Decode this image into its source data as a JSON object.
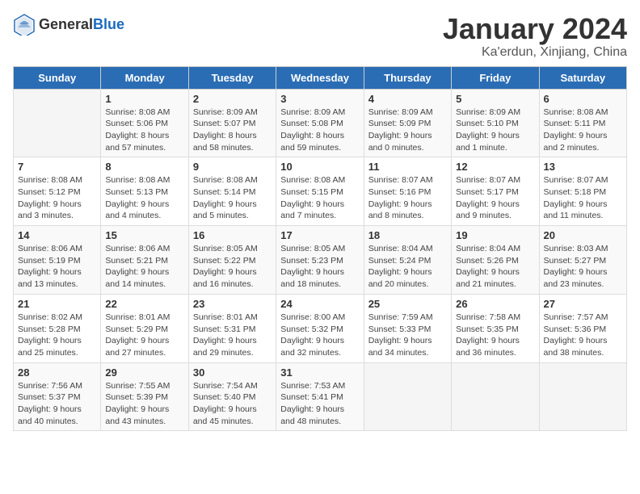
{
  "logo": {
    "text_general": "General",
    "text_blue": "Blue"
  },
  "title": "January 2024",
  "subtitle": "Ka'erdun, Xinjiang, China",
  "days_of_week": [
    "Sunday",
    "Monday",
    "Tuesday",
    "Wednesday",
    "Thursday",
    "Friday",
    "Saturday"
  ],
  "weeks": [
    [
      {
        "day": "",
        "info": ""
      },
      {
        "day": "1",
        "info": "Sunrise: 8:08 AM\nSunset: 5:06 PM\nDaylight: 8 hours\nand 57 minutes."
      },
      {
        "day": "2",
        "info": "Sunrise: 8:09 AM\nSunset: 5:07 PM\nDaylight: 8 hours\nand 58 minutes."
      },
      {
        "day": "3",
        "info": "Sunrise: 8:09 AM\nSunset: 5:08 PM\nDaylight: 8 hours\nand 59 minutes."
      },
      {
        "day": "4",
        "info": "Sunrise: 8:09 AM\nSunset: 5:09 PM\nDaylight: 9 hours\nand 0 minutes."
      },
      {
        "day": "5",
        "info": "Sunrise: 8:09 AM\nSunset: 5:10 PM\nDaylight: 9 hours\nand 1 minute."
      },
      {
        "day": "6",
        "info": "Sunrise: 8:08 AM\nSunset: 5:11 PM\nDaylight: 9 hours\nand 2 minutes."
      }
    ],
    [
      {
        "day": "7",
        "info": "Sunrise: 8:08 AM\nSunset: 5:12 PM\nDaylight: 9 hours\nand 3 minutes."
      },
      {
        "day": "8",
        "info": "Sunrise: 8:08 AM\nSunset: 5:13 PM\nDaylight: 9 hours\nand 4 minutes."
      },
      {
        "day": "9",
        "info": "Sunrise: 8:08 AM\nSunset: 5:14 PM\nDaylight: 9 hours\nand 5 minutes."
      },
      {
        "day": "10",
        "info": "Sunrise: 8:08 AM\nSunset: 5:15 PM\nDaylight: 9 hours\nand 7 minutes."
      },
      {
        "day": "11",
        "info": "Sunrise: 8:07 AM\nSunset: 5:16 PM\nDaylight: 9 hours\nand 8 minutes."
      },
      {
        "day": "12",
        "info": "Sunrise: 8:07 AM\nSunset: 5:17 PM\nDaylight: 9 hours\nand 9 minutes."
      },
      {
        "day": "13",
        "info": "Sunrise: 8:07 AM\nSunset: 5:18 PM\nDaylight: 9 hours\nand 11 minutes."
      }
    ],
    [
      {
        "day": "14",
        "info": "Sunrise: 8:06 AM\nSunset: 5:19 PM\nDaylight: 9 hours\nand 13 minutes."
      },
      {
        "day": "15",
        "info": "Sunrise: 8:06 AM\nSunset: 5:21 PM\nDaylight: 9 hours\nand 14 minutes."
      },
      {
        "day": "16",
        "info": "Sunrise: 8:05 AM\nSunset: 5:22 PM\nDaylight: 9 hours\nand 16 minutes."
      },
      {
        "day": "17",
        "info": "Sunrise: 8:05 AM\nSunset: 5:23 PM\nDaylight: 9 hours\nand 18 minutes."
      },
      {
        "day": "18",
        "info": "Sunrise: 8:04 AM\nSunset: 5:24 PM\nDaylight: 9 hours\nand 20 minutes."
      },
      {
        "day": "19",
        "info": "Sunrise: 8:04 AM\nSunset: 5:26 PM\nDaylight: 9 hours\nand 21 minutes."
      },
      {
        "day": "20",
        "info": "Sunrise: 8:03 AM\nSunset: 5:27 PM\nDaylight: 9 hours\nand 23 minutes."
      }
    ],
    [
      {
        "day": "21",
        "info": "Sunrise: 8:02 AM\nSunset: 5:28 PM\nDaylight: 9 hours\nand 25 minutes."
      },
      {
        "day": "22",
        "info": "Sunrise: 8:01 AM\nSunset: 5:29 PM\nDaylight: 9 hours\nand 27 minutes."
      },
      {
        "day": "23",
        "info": "Sunrise: 8:01 AM\nSunset: 5:31 PM\nDaylight: 9 hours\nand 29 minutes."
      },
      {
        "day": "24",
        "info": "Sunrise: 8:00 AM\nSunset: 5:32 PM\nDaylight: 9 hours\nand 32 minutes."
      },
      {
        "day": "25",
        "info": "Sunrise: 7:59 AM\nSunset: 5:33 PM\nDaylight: 9 hours\nand 34 minutes."
      },
      {
        "day": "26",
        "info": "Sunrise: 7:58 AM\nSunset: 5:35 PM\nDaylight: 9 hours\nand 36 minutes."
      },
      {
        "day": "27",
        "info": "Sunrise: 7:57 AM\nSunset: 5:36 PM\nDaylight: 9 hours\nand 38 minutes."
      }
    ],
    [
      {
        "day": "28",
        "info": "Sunrise: 7:56 AM\nSunset: 5:37 PM\nDaylight: 9 hours\nand 40 minutes."
      },
      {
        "day": "29",
        "info": "Sunrise: 7:55 AM\nSunset: 5:39 PM\nDaylight: 9 hours\nand 43 minutes."
      },
      {
        "day": "30",
        "info": "Sunrise: 7:54 AM\nSunset: 5:40 PM\nDaylight: 9 hours\nand 45 minutes."
      },
      {
        "day": "31",
        "info": "Sunrise: 7:53 AM\nSunset: 5:41 PM\nDaylight: 9 hours\nand 48 minutes."
      },
      {
        "day": "",
        "info": ""
      },
      {
        "day": "",
        "info": ""
      },
      {
        "day": "",
        "info": ""
      }
    ]
  ]
}
